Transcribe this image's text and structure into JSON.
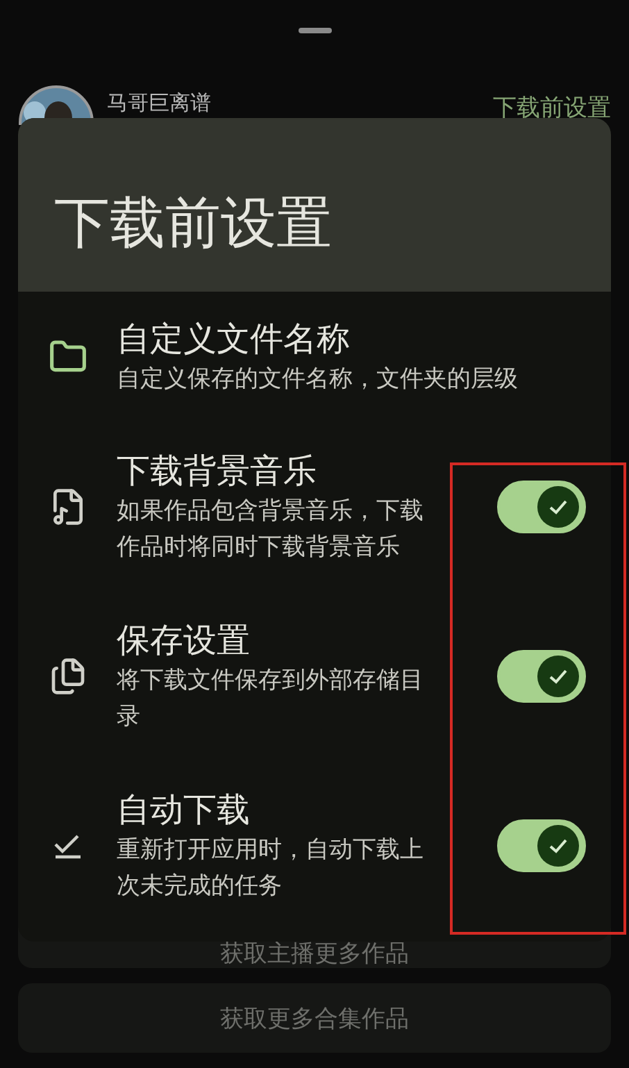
{
  "background": {
    "author": "马哥巨离谱",
    "header_action": "下载前设置",
    "buttons": [
      "获取主播更多作品",
      "获取更多合集作品"
    ]
  },
  "dialog": {
    "title": "下载前设置",
    "items": [
      {
        "kind": "link",
        "title": "自定义文件名称",
        "subtitle": "自定义保存的文件名称，文件夹的层级"
      },
      {
        "kind": "toggle",
        "title": "下载背景音乐",
        "subtitle": "如果作品包含背景音乐，下载作品时将同时下载背景音乐",
        "on": true
      },
      {
        "kind": "toggle",
        "title": "保存设置",
        "subtitle": "将下载文件保存到外部存储目录",
        "on": true
      },
      {
        "kind": "toggle",
        "title": "自动下载",
        "subtitle": "重新打开应用时，自动下载上次未完成的任务",
        "on": true
      }
    ]
  }
}
